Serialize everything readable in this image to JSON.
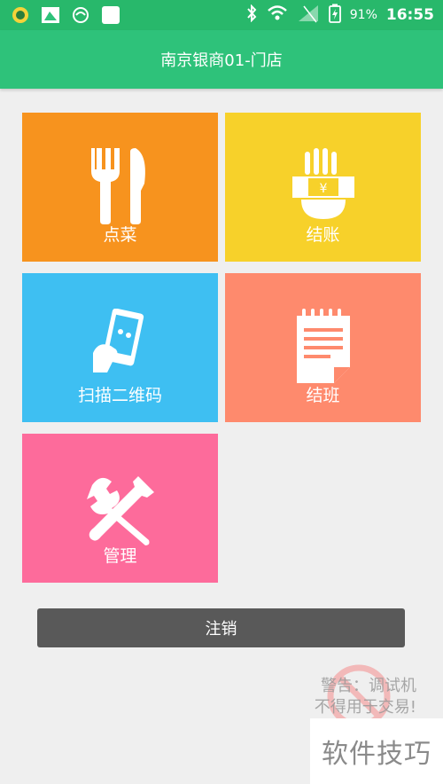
{
  "status_bar": {
    "battery_percent": "91%",
    "time": "16:55",
    "icons": [
      "app-notification-icon",
      "image-notification-icon",
      "gauge-notification-icon",
      "blank-notification-icon",
      "bluetooth-icon",
      "wifi-icon",
      "signal-icon",
      "battery-charging-icon"
    ]
  },
  "header": {
    "title": "南京银商01-门店"
  },
  "tiles": [
    {
      "key": "order",
      "label": "点菜",
      "color": "#f7931e",
      "icon": "fork-knife-icon"
    },
    {
      "key": "checkout",
      "label": "结账",
      "color": "#f7d12a",
      "icon": "hand-money-icon"
    },
    {
      "key": "scan",
      "label": "扫描二维码",
      "color": "#3ebff2",
      "icon": "phone-scan-icon"
    },
    {
      "key": "shift",
      "label": "结班",
      "color": "#fe8a6d",
      "icon": "notepad-icon"
    },
    {
      "key": "manage",
      "label": "管理",
      "color": "#fd6b9b",
      "icon": "wrench-screwdriver-icon"
    }
  ],
  "logout_label": "注销",
  "watermark": {
    "line1": "警告：调试机",
    "line2": "不得用于交易!"
  },
  "corner_text": "软件技巧"
}
